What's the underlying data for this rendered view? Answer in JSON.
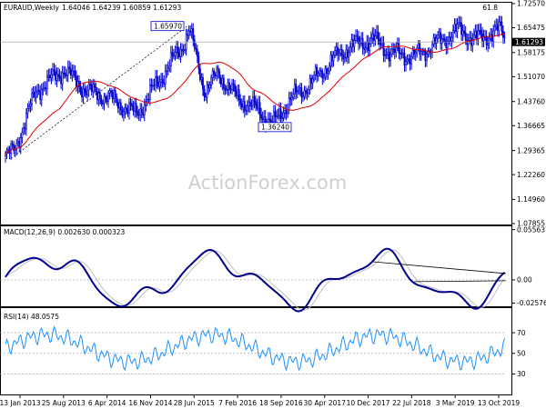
{
  "chart_data": [
    {
      "type": "candlestick",
      "title": "EURAUD,Weekly",
      "ohlc_label": "1.64046 1.64239 1.60859 1.61293",
      "corner_label": "61.8",
      "watermark": "ActionForex.com",
      "last_price": 1.61293,
      "last_price_label": "1.61293",
      "y_ticks": [
        "1.72570",
        "1.65475",
        "1.58175",
        "1.51070",
        "1.43760",
        "1.36665",
        "1.29365",
        "1.22260",
        "1.14960",
        "1.07855"
      ],
      "ylim": [
        1.0785,
        1.7257
      ],
      "annotations": [
        {
          "label": "1.65970",
          "value": 1.6597
        },
        {
          "label": "1.36240",
          "value": 1.3624
        }
      ],
      "series": [
        {
          "type": "candles",
          "color": "#0000cc"
        },
        {
          "type": "moving-average",
          "color": "#e00000"
        }
      ],
      "x_ticks": [
        "13 Jan 2013",
        "25 Aug 2013",
        "6 Apr 2014",
        "16 Nov 2014",
        "28 Jun 2015",
        "7 Feb 2016",
        "18 Sep 2016",
        "30 Apr 2017",
        "10 Dec 2017",
        "22 Jul 2018",
        "3 Mar 2019",
        "13 Oct 2019"
      ]
    },
    {
      "type": "line",
      "title": "MACD(12,26,9) 0.002630 0.000323",
      "y_ticks": [
        "0.055637",
        "0.00",
        "-0.02576"
      ],
      "ylim": [
        -0.0283,
        0.0583
      ],
      "zero_line": true,
      "series": [
        {
          "type": "macd",
          "color": "#00008b"
        },
        {
          "type": "signal",
          "color": "#c0c0c0"
        }
      ]
    },
    {
      "type": "line",
      "title": "RSI(14) 48.0575",
      "y_ticks": [
        "70",
        "50",
        "30"
      ],
      "ylim": [
        11,
        93
      ],
      "levels": [
        70,
        50,
        30
      ],
      "series": [
        {
          "type": "rsi",
          "color": "#1e90ff"
        }
      ]
    }
  ],
  "colors": {
    "candle": "#0000cc",
    "moving_average": "#e00000",
    "macd": "#00008b",
    "signal": "#c0c0c0",
    "rsi": "#1e90ff",
    "watermark": "#cfcfcf"
  }
}
